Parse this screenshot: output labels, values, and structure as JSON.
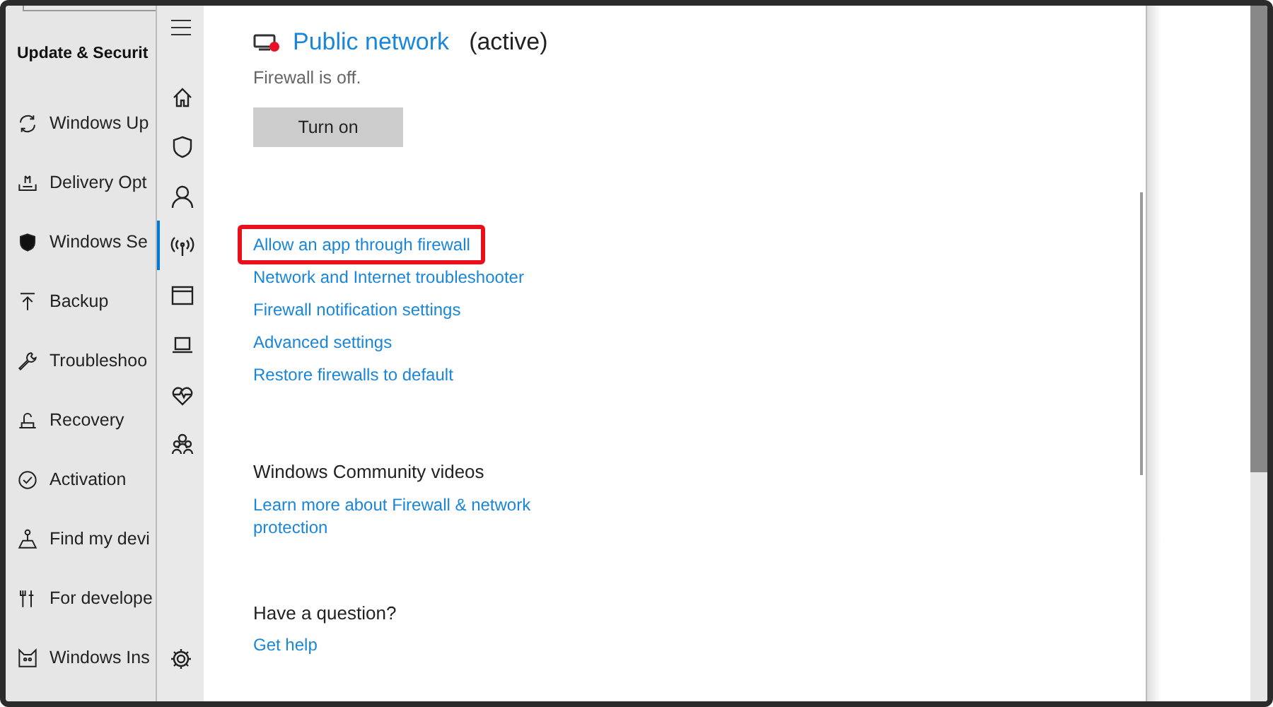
{
  "settings_sidebar": {
    "heading": "Update & Securit",
    "items": [
      {
        "label": "Windows Up"
      },
      {
        "label": "Delivery Opt"
      },
      {
        "label": "Windows Se"
      },
      {
        "label": "Backup"
      },
      {
        "label": "Troubleshoo"
      },
      {
        "label": "Recovery"
      },
      {
        "label": "Activation"
      },
      {
        "label": "Find my devi"
      },
      {
        "label": "For develope"
      },
      {
        "label": "Windows Ins"
      }
    ]
  },
  "security_rail": {
    "items": [
      {
        "selected": false
      },
      {
        "selected": false
      },
      {
        "selected": false
      },
      {
        "selected": true
      },
      {
        "selected": false
      },
      {
        "selected": false
      },
      {
        "selected": false
      },
      {
        "selected": false
      }
    ]
  },
  "network": {
    "name": "Public network",
    "status": "(active)",
    "message": "Firewall is off.",
    "button": "Turn on"
  },
  "links": [
    {
      "label": "Allow an app through firewall",
      "highlighted": true
    },
    {
      "label": "Network and Internet troubleshooter",
      "highlighted": false
    },
    {
      "label": "Firewall notification settings",
      "highlighted": false
    },
    {
      "label": "Advanced settings",
      "highlighted": false
    },
    {
      "label": "Restore firewalls to default",
      "highlighted": false
    }
  ],
  "community": {
    "heading": "Windows Community videos",
    "link": "Learn more about Firewall & network protection"
  },
  "question": {
    "heading": "Have a question?",
    "link": "Get help"
  }
}
